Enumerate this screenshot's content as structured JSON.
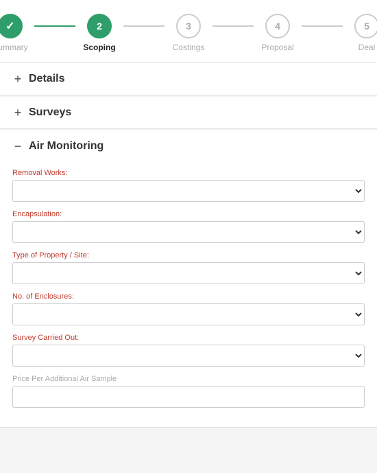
{
  "stepper": {
    "steps": [
      {
        "id": 1,
        "label": "Summary",
        "state": "completed"
      },
      {
        "id": 2,
        "label": "Scoping",
        "state": "active"
      },
      {
        "id": 3,
        "label": "Costings",
        "state": "inactive"
      },
      {
        "id": 4,
        "label": "Proposal",
        "state": "inactive"
      },
      {
        "id": 5,
        "label": "Deal",
        "state": "inactive"
      }
    ]
  },
  "sections": [
    {
      "id": "details",
      "label": "Details",
      "expanded": false,
      "toggle": "+"
    },
    {
      "id": "surveys",
      "label": "Surveys",
      "expanded": false,
      "toggle": "+"
    },
    {
      "id": "air-monitoring",
      "label": "Air Monitoring",
      "expanded": true,
      "toggle": "−"
    }
  ],
  "air_monitoring": {
    "fields": [
      {
        "id": "removal-works",
        "label": "Removal Works:",
        "type": "select",
        "labelColor": "red"
      },
      {
        "id": "encapsulation",
        "label": "Encapsulation:",
        "type": "select",
        "labelColor": "red"
      },
      {
        "id": "type-of-property",
        "label": "Type of Property / Site:",
        "type": "select",
        "labelColor": "red"
      },
      {
        "id": "no-of-enclosures",
        "label": "No. of Enclosures:",
        "type": "select",
        "labelColor": "red"
      },
      {
        "id": "survey-carried-out",
        "label": "Survey Carried Out:",
        "type": "select",
        "labelColor": "red"
      },
      {
        "id": "price-per-additional",
        "label": "Price Per Additional Air Sample",
        "type": "input",
        "labelColor": "gray"
      }
    ]
  }
}
